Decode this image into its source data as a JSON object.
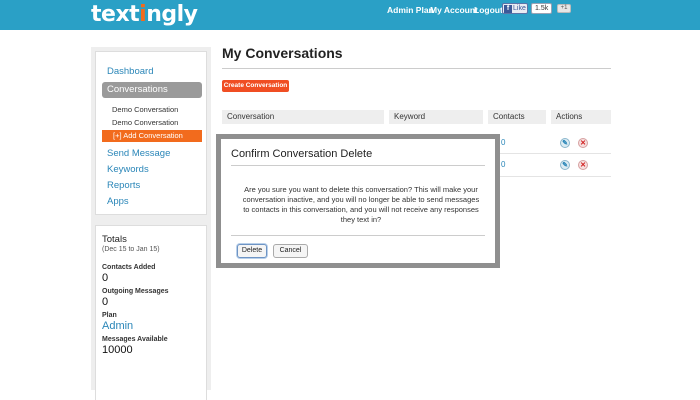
{
  "header": {
    "logo_prefix": "text",
    "logo_accent": "i",
    "logo_suffix": "ngly",
    "nav": [
      "Admin Plan",
      "My Account",
      "Logout"
    ],
    "fb_like_label": "Like",
    "fb_like_count": "1.5k",
    "gplus_label": "+1"
  },
  "sidebar": {
    "dashboard": "Dashboard",
    "conversations": "Conversations",
    "conversation_items": [
      "Demo Conversation",
      "Demo Conversation"
    ],
    "add_conversation": "[+] Add Conversation",
    "send_message": "Send Message",
    "keywords": "Keywords",
    "reports": "Reports",
    "apps": "Apps"
  },
  "totals": {
    "title": "Totals",
    "range": "(Dec 15 to Jan 15)",
    "contacts_added_label": "Contacts Added",
    "contacts_added": "0",
    "outgoing_label": "Outgoing Messages",
    "outgoing": "0",
    "plan_label": "Plan",
    "plan": "Admin",
    "messages_available_label": "Messages Available",
    "messages_available": "10000"
  },
  "main": {
    "title": "My Conversations",
    "create_button": "Create Conversation",
    "columns": [
      "Conversation",
      "Keyword",
      "Contacts",
      "Actions"
    ],
    "rows": [
      {
        "contacts": "0"
      },
      {
        "contacts": "0"
      }
    ]
  },
  "modal": {
    "title": "Confirm Conversation Delete",
    "body": "Are you sure you want to delete this conversation? This will make your conversation inactive, and you will no longer be able to send messages to contacts in this conversation, and you will not receive any responses they text in?",
    "delete_label": "Delete",
    "cancel_label": "Cancel"
  },
  "colors": {
    "topbar": "#2aa0c6",
    "accent_orange": "#f26b1d",
    "link_blue": "#2a86b8",
    "create_button": "#f04e23"
  },
  "icons": {
    "edit": "wrench-icon",
    "delete": "delete-x-icon"
  }
}
